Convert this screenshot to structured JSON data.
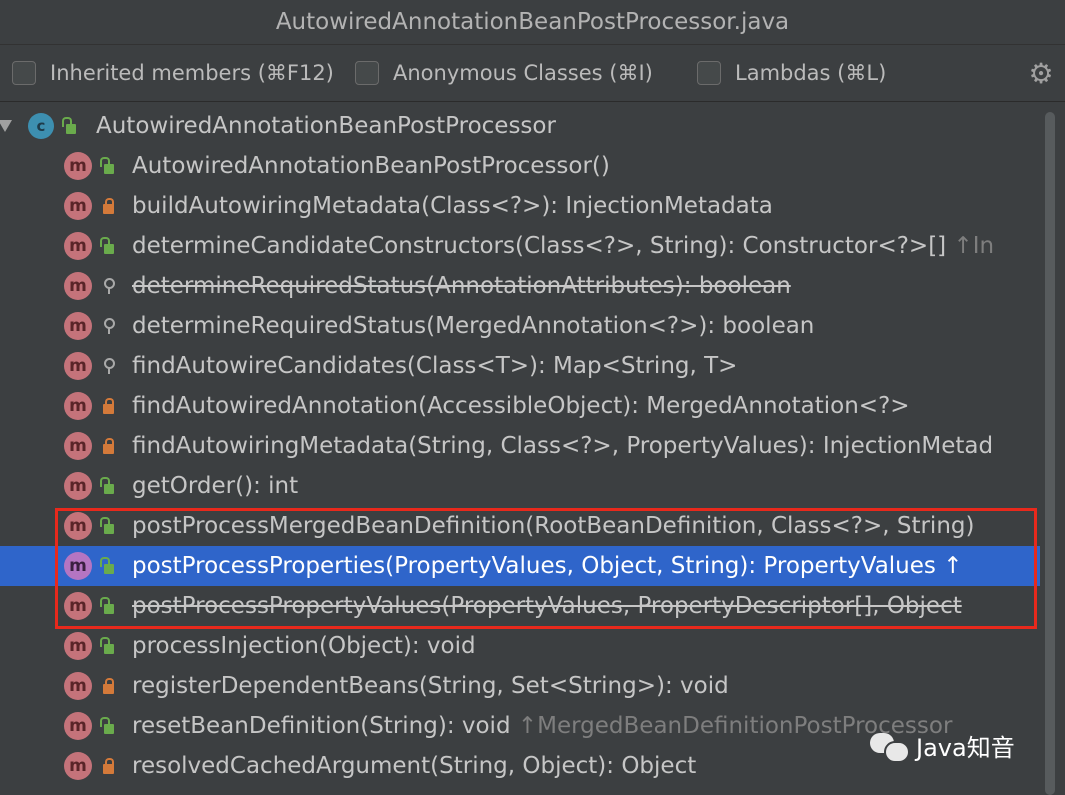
{
  "window": {
    "title": "AutowiredAnnotationBeanPostProcessor.java"
  },
  "toolbar": {
    "inherited": {
      "label": "Inherited members (⌘F12)",
      "checked": false
    },
    "anonymous": {
      "label": "Anonymous Classes (⌘I)",
      "checked": false
    },
    "lambdas": {
      "label": "Lambdas (⌘L)",
      "checked": false
    }
  },
  "tree": {
    "class_name": "AutowiredAnnotationBeanPostProcessor",
    "class_icon_letter": "c",
    "method_icon_letter": "m",
    "members": [
      {
        "text": "AutowiredAnnotationBeanPostProcessor()",
        "access": "public",
        "deprecated": false,
        "inherited": ""
      },
      {
        "text": "buildAutowiringMetadata(Class<?>): InjectionMetadata",
        "access": "private",
        "deprecated": false,
        "inherited": ""
      },
      {
        "text": "determineCandidateConstructors(Class<?>, String): Constructor<?>[]",
        "access": "public",
        "deprecated": false,
        "inherited": "↑In"
      },
      {
        "text": "determineRequiredStatus(AnnotationAttributes): boolean",
        "access": "protected",
        "deprecated": true,
        "inherited": ""
      },
      {
        "text": "determineRequiredStatus(MergedAnnotation<?>): boolean",
        "access": "protected",
        "deprecated": false,
        "inherited": ""
      },
      {
        "text": "findAutowireCandidates(Class<T>): Map<String, T>",
        "access": "protected",
        "deprecated": false,
        "inherited": ""
      },
      {
        "text": "findAutowiredAnnotation(AccessibleObject): MergedAnnotation<?>",
        "access": "private",
        "deprecated": false,
        "inherited": ""
      },
      {
        "text": "findAutowiringMetadata(String, Class<?>, PropertyValues): InjectionMetad",
        "access": "private",
        "deprecated": false,
        "inherited": ""
      },
      {
        "text": "getOrder(): int",
        "access": "public",
        "deprecated": false,
        "inherited": ""
      },
      {
        "text": "postProcessMergedBeanDefinition(RootBeanDefinition, Class<?>, String)",
        "access": "public",
        "deprecated": false,
        "inherited": ""
      },
      {
        "text": "postProcessProperties(PropertyValues, Object, String): PropertyValues",
        "access": "public",
        "deprecated": false,
        "inherited": "↑",
        "selected": true
      },
      {
        "text": "postProcessPropertyValues(PropertyValues, PropertyDescriptor[], Object",
        "access": "public",
        "deprecated": true,
        "inherited": ""
      },
      {
        "text": "processInjection(Object): void",
        "access": "public",
        "deprecated": false,
        "inherited": ""
      },
      {
        "text": "registerDependentBeans(String, Set<String>): void",
        "access": "private",
        "deprecated": false,
        "inherited": ""
      },
      {
        "text": "resetBeanDefinition(String): void",
        "access": "public",
        "deprecated": false,
        "inherited": "↑MergedBeanDefinitionPostProcessor"
      },
      {
        "text": "resolvedCachedArgument(String, Object): Object",
        "access": "private",
        "deprecated": false,
        "inherited": ""
      }
    ]
  },
  "watermark": {
    "text": "Java知音"
  },
  "colors": {
    "selection": "#2f65ca",
    "highlight_box": "#e8291c",
    "background": "#3c3f41"
  }
}
